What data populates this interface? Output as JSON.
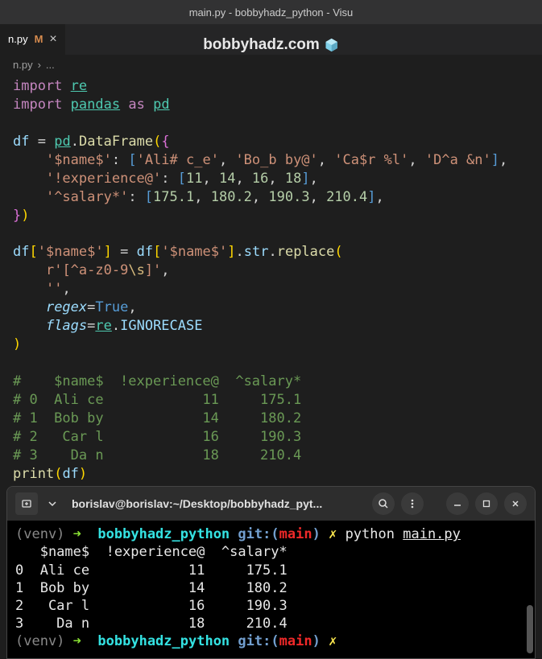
{
  "titlebar": {
    "text": "main.py - bobbyhadz_python - Visu"
  },
  "watermark": {
    "text": "bobbyhadz.com"
  },
  "tab": {
    "name": "n.py",
    "modified": "M",
    "close": "×"
  },
  "breadcrumb": {
    "file": "n.py",
    "sep": "›",
    "more": "..."
  },
  "code": {
    "import": "import",
    "re": "re",
    "pandas": "pandas",
    "as": "as",
    "pd": "pd",
    "df": "df",
    "eq": "=",
    "dot": ".",
    "DataFrame": "DataFrame",
    "name_key": "'$name$'",
    "exp_key": "'!experience@'",
    "sal_key": "'^salary*'",
    "names": [
      "'Ali# c_e'",
      "'Bo_b by@'",
      "'Ca$r %l'",
      "'D^a &n'"
    ],
    "exps": [
      "11",
      "14",
      "16",
      "18"
    ],
    "sals": [
      "175.1",
      "180.2",
      "190.3",
      "210.4"
    ],
    "str_attr": "str",
    "replace": "replace",
    "regex_prefix": "r",
    "regex_body": "'[^a-z0-9",
    "regex_esc": "\\s",
    "regex_end": "]'",
    "empty": "''",
    "regex_param": "regex",
    "flags_param": "flags",
    "true": "True",
    "IGNORECASE": "IGNORECASE",
    "comments": [
      "#    $name$  !experience@  ^salary*",
      "# 0  Ali ce            11     175.1",
      "# 1  Bob by            14     180.2",
      "# 2   Car l            16     190.3",
      "# 3    Da n            18     210.4"
    ],
    "print": "print"
  },
  "terminal": {
    "title": "borislav@borislav:~/Desktop/bobbyhadz_pyt...",
    "venv": "(venv)",
    "arrow": "➜",
    "dir": "bobbyhadz_python",
    "git": "git:(",
    "branch": "main",
    "git_close": ")",
    "dirty": "✗",
    "cmd_python": "python",
    "cmd_file": "main.py",
    "output": [
      "   $name$  !experience@  ^salary*",
      "0  Ali ce            11     175.1",
      "1  Bob by            14     180.2",
      "2   Car l            16     190.3",
      "3    Da n            18     210.4"
    ]
  }
}
